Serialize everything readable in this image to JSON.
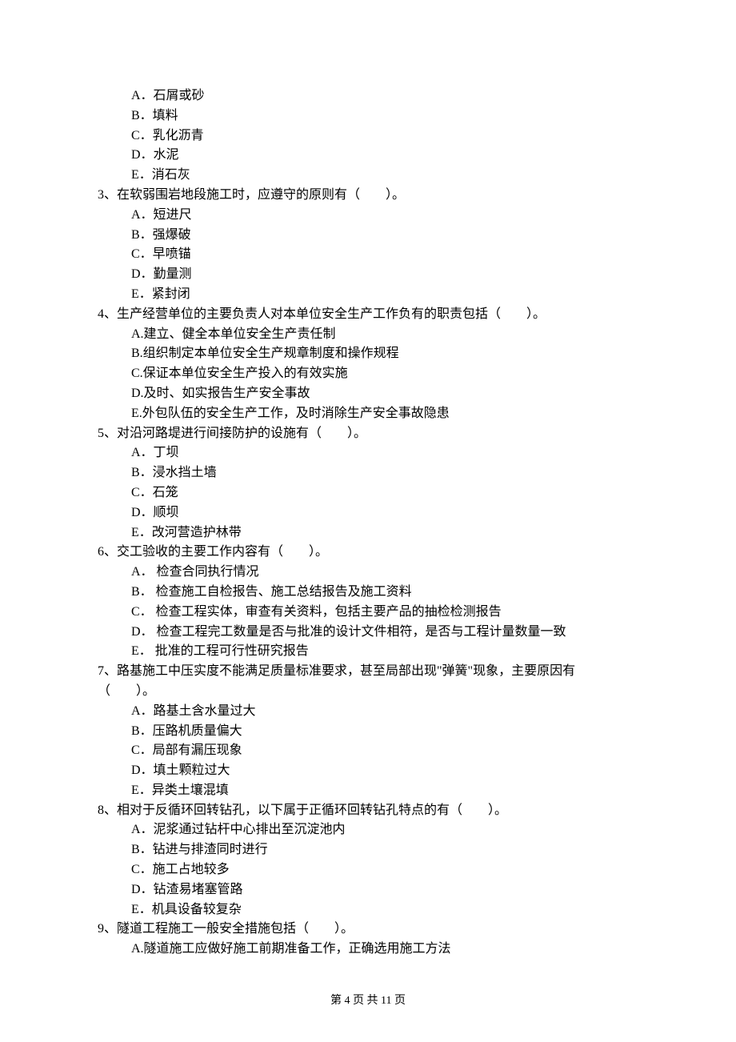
{
  "q2": {
    "options": {
      "A": "A．石屑或砂",
      "B": "B．填料",
      "C": "C．乳化沥青",
      "D": "D．水泥",
      "E": "E．消石灰"
    }
  },
  "q3": {
    "stem": "3、在软弱围岩地段施工时，应遵守的原则有（　　）。",
    "options": {
      "A": "A．短进尺",
      "B": "B．强爆破",
      "C": "C．早喷锚",
      "D": "D．勤量测",
      "E": "E．紧封闭"
    }
  },
  "q4": {
    "stem": "4、生产经营单位的主要负责人对本单位安全生产工作负有的职责包括（　　）。",
    "options": {
      "A": "A.建立、健全本单位安全生产责任制",
      "B": "B.组织制定本单位安全生产规章制度和操作规程",
      "C": "C.保证本单位安全生产投入的有效实施",
      "D": "D.及时、如实报告生产安全事故",
      "E": "E.外包队伍的安全生产工作，及时消除生产安全事故隐患"
    }
  },
  "q5": {
    "stem": "5、对沿河路堤进行间接防护的设施有（　　）。",
    "options": {
      "A": "A．丁坝",
      "B": "B．浸水挡土墙",
      "C": "C．石笼",
      "D": "D．顺坝",
      "E": "E．改河营造护林带"
    }
  },
  "q6": {
    "stem": "6、交工验收的主要工作内容有（　　）。",
    "options": {
      "A": "A． 检查合同执行情况",
      "B": "B． 检查施工自检报告、施工总结报告及施工资料",
      "C": "C． 检查工程实体，审查有关资料，包括主要产品的抽检检测报告",
      "D": "D． 检查工程完工数量是否与批准的设计文件相符，是否与工程计量数量一致",
      "E": "E． 批准的工程可行性研究报告"
    }
  },
  "q7": {
    "stem1": "7、路基施工中压实度不能满足质量标准要求，甚至局部出现\"弹簧\"现象，主要原因有",
    "stem2": "（　　）。",
    "options": {
      "A": "A．路基土含水量过大",
      "B": "B．压路机质量偏大",
      "C": "C．局部有漏压现象",
      "D": "D．填土颗粒过大",
      "E": "E．异类土壤混填"
    }
  },
  "q8": {
    "stem": "8、相对于反循环回转钻孔，以下属于正循环回转钻孔特点的有（　　）。",
    "options": {
      "A": "A．泥浆通过钻杆中心排出至沉淀池内",
      "B": "B．钻进与排渣同时进行",
      "C": "C．施工占地较多",
      "D": "D．钻渣易堵塞管路",
      "E": "E．机具设备较复杂"
    }
  },
  "q9": {
    "stem": "9、隧道工程施工一般安全措施包括（　　）。",
    "options": {
      "A": "A.隧道施工应做好施工前期准备工作，正确选用施工方法"
    }
  },
  "footer": "第 4 页 共 11 页"
}
